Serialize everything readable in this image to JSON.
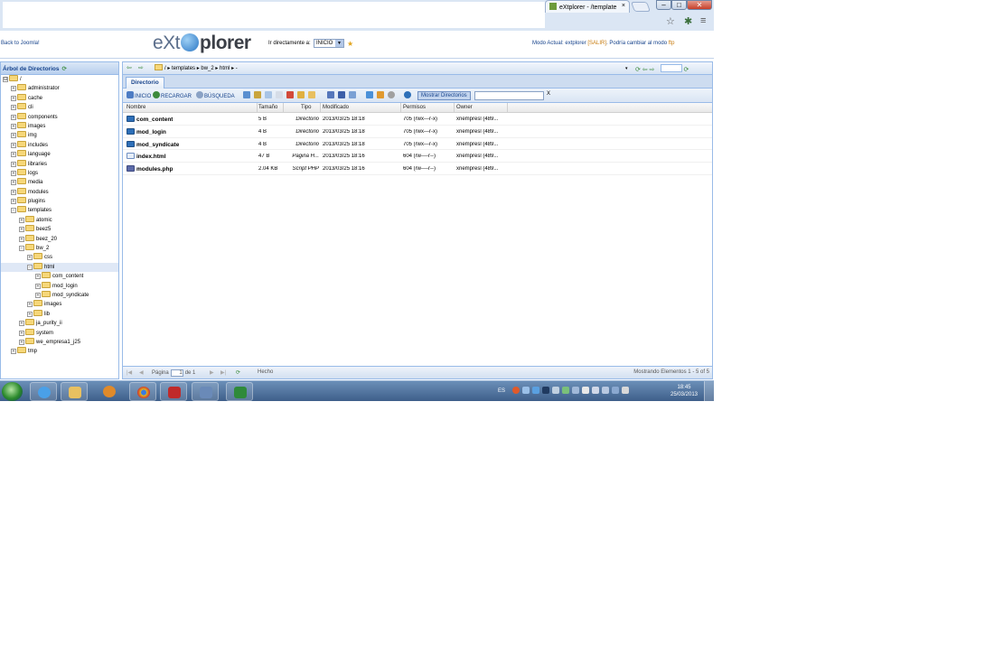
{
  "browser": {
    "tab_title": "eXtplorer - /template",
    "tab_close": "×",
    "min": "–",
    "max": "□",
    "close": "✕",
    "star_icon": "☆",
    "menu_icon": "≡"
  },
  "header": {
    "back_link": "Back to Joomla!",
    "logo_left": "eXt",
    "logo_right": "plorer",
    "goto_label": "Ir directamente a:",
    "goto_value": "INICIO",
    "mode_prefix": "Modo Actual: extplorer",
    "mode_logout": "[SALIR]",
    "mode_switch_text": ". Podría cambiar al modo",
    "mode_switch_link": "ftp"
  },
  "tree": {
    "title": "Árbol de Directorios",
    "items": [
      {
        "label": "/",
        "depth": 0,
        "expander": "⊟"
      },
      {
        "label": "administrator",
        "depth": 1,
        "expander": "+"
      },
      {
        "label": "cache",
        "depth": 1,
        "expander": "+"
      },
      {
        "label": "cli",
        "depth": 1,
        "expander": "+"
      },
      {
        "label": "components",
        "depth": 1,
        "expander": "+"
      },
      {
        "label": "images",
        "depth": 1,
        "expander": "+"
      },
      {
        "label": "img",
        "depth": 1,
        "expander": "+"
      },
      {
        "label": "includes",
        "depth": 1,
        "expander": "+"
      },
      {
        "label": "language",
        "depth": 1,
        "expander": "+"
      },
      {
        "label": "libraries",
        "depth": 1,
        "expander": "+"
      },
      {
        "label": "logs",
        "depth": 1,
        "expander": "+"
      },
      {
        "label": "media",
        "depth": 1,
        "expander": "+"
      },
      {
        "label": "modules",
        "depth": 1,
        "expander": "+"
      },
      {
        "label": "plugins",
        "depth": 1,
        "expander": "+"
      },
      {
        "label": "templates",
        "depth": 1,
        "expander": "−"
      },
      {
        "label": "atomic",
        "depth": 2,
        "expander": "+"
      },
      {
        "label": "beez5",
        "depth": 2,
        "expander": "+"
      },
      {
        "label": "beez_20",
        "depth": 2,
        "expander": "+"
      },
      {
        "label": "bw_2",
        "depth": 2,
        "expander": "−"
      },
      {
        "label": "css",
        "depth": 3,
        "expander": "+"
      },
      {
        "label": "html",
        "depth": 3,
        "expander": "−",
        "selected": true
      },
      {
        "label": "com_content",
        "depth": 4,
        "expander": "+"
      },
      {
        "label": "mod_login",
        "depth": 4,
        "expander": "+"
      },
      {
        "label": "mod_syndicate",
        "depth": 4,
        "expander": "+"
      },
      {
        "label": "images",
        "depth": 3,
        "expander": "+"
      },
      {
        "label": "lib",
        "depth": 3,
        "expander": "+"
      },
      {
        "label": "ja_purity_ii",
        "depth": 2,
        "expander": "+"
      },
      {
        "label": "system",
        "depth": 2,
        "expander": "+"
      },
      {
        "label": "we_empresa1_j25",
        "depth": 2,
        "expander": "+"
      },
      {
        "label": "tmp",
        "depth": 1,
        "expander": "+"
      }
    ]
  },
  "pathbar": {
    "path": "/ ▸ templates ▸ bw_2 ▸ html ▸ -",
    "dropdown": "▾",
    "back_icon": "⇦",
    "forward_icon": "⇨"
  },
  "tabs": {
    "directory": "Directorio"
  },
  "toolbar": {
    "home": "INICIO",
    "reload": "RECARGAR",
    "search": "BÚSQUEDA",
    "show_dirs": "Mostrar Directorios",
    "filter_clear": "X"
  },
  "grid": {
    "columns": [
      "Nombre",
      "Tamaño",
      "Tipo",
      "Modificado",
      "Permisos",
      "Owner"
    ],
    "rows": [
      {
        "name": "com_content",
        "size": "5 B",
        "type": "Directorio",
        "modified": "2013/03/25 18:18",
        "perms": "705 (rwx---r-x)",
        "owner": "xnempresl (489...",
        "icon": "dir"
      },
      {
        "name": "mod_login",
        "size": "4 B",
        "type": "Directorio",
        "modified": "2013/03/25 18:18",
        "perms": "705 (rwx---r-x)",
        "owner": "xnempresl (489...",
        "icon": "dir"
      },
      {
        "name": "mod_syndicate",
        "size": "4 B",
        "type": "Directorio",
        "modified": "2013/03/25 18:18",
        "perms": "705 (rwx---r-x)",
        "owner": "xnempresl (489...",
        "icon": "dir"
      },
      {
        "name": "index.html",
        "size": "47 B",
        "type": "Pagina H...",
        "modified": "2013/03/25 18:16",
        "perms": "604 (rw----r--)",
        "owner": "xnempresl (489...",
        "icon": "html"
      },
      {
        "name": "modules.php",
        "size": "2.04 KB",
        "type": "Script PHP",
        "modified": "2013/03/25 18:16",
        "perms": "604 (rw----r--)",
        "owner": "xnempresl (489...",
        "icon": "php"
      }
    ]
  },
  "statusbar": {
    "page_label": "Página",
    "page_value": "1",
    "of_label": "de 1",
    "status": "Hecho",
    "showing": "Mostrando Elementos 1 - 5 of 5"
  },
  "taskbar": {
    "lang": "ES",
    "time": "18:45",
    "date": "25/03/2013"
  },
  "colors": {
    "panel_border": "#99bbe8",
    "header_text": "#15428b",
    "folder": "#f6d77a",
    "taskbar": "#3e5f8a"
  }
}
